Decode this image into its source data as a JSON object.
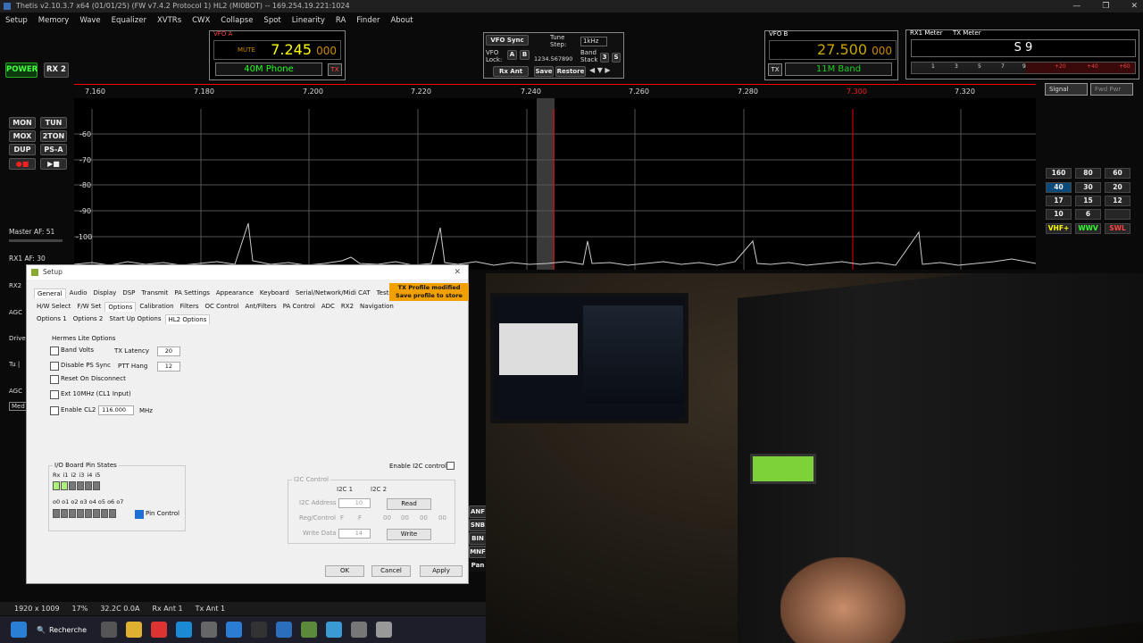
{
  "window": {
    "title": "Thetis v2.10.3.7 x64 (01/01/25) (FW v7.4.2 Protocol 1) HL2 (MI0BOT)  --  169.254.19.221:1024",
    "buttons": [
      "—",
      "❐",
      "✕"
    ]
  },
  "menu": [
    "Setup",
    "Memory",
    "Wave",
    "Equalizer",
    "XVTRs",
    "CWX",
    "Collapse",
    "Spot",
    "Linearity",
    "RA",
    "Finder",
    "About"
  ],
  "power": "POWER",
  "rx2": "RX 2",
  "vfo_a": {
    "label": "VFO A",
    "mute": "MUTE",
    "freq_main": "7.245",
    "freq_sub": "000",
    "band": "40M Phone",
    "tx": "TX"
  },
  "vfo_b": {
    "label": "VFO B",
    "freq_main": "27.500",
    "freq_sub": "000",
    "band": "11M Band",
    "tx": "TX"
  },
  "vfo_sync": {
    "sync": "VFO Sync",
    "tune_step": "Tune Step:",
    "step_val": "1kHz",
    "vfo_lock": "VFO Lock:",
    "a": "A",
    "b": "B",
    "digits": "1234.567890",
    "band_stack": "Band Stack",
    "stack_num": "3",
    "s": "S",
    "rx_ant": "Rx Ant",
    "save": "Save",
    "restore": "Restore"
  },
  "meters": {
    "rx_label": "RX1 Meter",
    "tx_label": "TX Meter",
    "reading": "S 9",
    "scale": [
      "1",
      "3",
      "5",
      "7",
      "9",
      "+20",
      "+40",
      "+60"
    ]
  },
  "freq_axis": [
    "7.160",
    "7.180",
    "7.200",
    "7.220",
    "7.240",
    "7.260",
    "7.280",
    "7.300",
    "7.320"
  ],
  "db_axis": [
    "-60",
    "-70",
    "-80",
    "-90",
    "-100"
  ],
  "left_buttons": [
    "MON",
    "TUN",
    "MOX",
    "2TON",
    "DUP",
    "PS-A"
  ],
  "master_af": "Master AF:  51",
  "rx1_af": "RX1 AF:  30",
  "left_labels": [
    "RX2",
    "AGC",
    "Drive",
    "Tu |",
    "AGC",
    "Med"
  ],
  "side_buttons": [
    "ANF",
    "SNB",
    "BIN",
    "MNF",
    "Pan"
  ],
  "bands": [
    "160",
    "80",
    "60",
    "40",
    "30",
    "20",
    "17",
    "15",
    "12",
    "10",
    "6",
    "",
    "VHF+",
    "WWV",
    "SWL"
  ],
  "signal_select": "Signal",
  "fwd_select": "Fwd Pwr",
  "setup": {
    "title": "Setup",
    "tabs1": [
      "General",
      "Audio",
      "Display",
      "DSP",
      "Transmit",
      "PA Settings",
      "Appearance",
      "Keyboard",
      "Serial/Network/Midi CAT",
      "Tests"
    ],
    "warning": "TX Profile modified\nSave profile to store",
    "tabs2": [
      "H/W Select",
      "F/W Set",
      "Options",
      "Calibration",
      "Filters",
      "OC Control",
      "Ant/Filters",
      "PA Control",
      "ADC",
      "RX2",
      "Navigation"
    ],
    "tabs3": [
      "Options 1",
      "Options 2",
      "Start Up Options",
      "HL2 Options"
    ],
    "hl_group": "Hermes Lite Options",
    "band_volts": "Band Volts",
    "tx_latency": "TX Latency",
    "tx_latency_val": "20",
    "disable_ps": "Disable PS Sync",
    "ptt_hang": "PTT Hang",
    "ptt_hang_val": "12",
    "reset": "Reset On Disconnect",
    "ext10": "Ext 10MHz (CL1 Input)",
    "enable_cl2": "Enable CL2",
    "cl2_val": "116.000",
    "mhz": "MHz",
    "io_group": "I/O Board Pin States",
    "io_in_labels": "Rx  i1  i2  i3  i4  i5",
    "io_out_labels": "o0  o1  o2  o3 o4  o5  o6  o7",
    "pin_control": "Pin Control",
    "enable_i2c": "Enable I2C control",
    "i2c_group": "I2C Control",
    "i2c1": "I2C 1",
    "i2c2": "I2C 2",
    "i2c_addr": "I2C Address",
    "i2c_addr_val": "10",
    "read": "Read",
    "reg_ctrl": "Reg/Control",
    "reg_vals": [
      "F",
      "F",
      "00",
      "00",
      "00",
      "00"
    ],
    "write_data": "Write Data",
    "write_val": "14",
    "write": "Write",
    "ok": "OK",
    "cancel": "Cancel",
    "apply": "Apply"
  },
  "status": {
    "resolution": "1920 x 1009",
    "cpu": "17%",
    "temp": "32.2C  0.0A",
    "rx_ant": "Rx Ant 1",
    "tx_ant": "Tx Ant 1"
  },
  "taskbar": {
    "search": "Recherche"
  }
}
